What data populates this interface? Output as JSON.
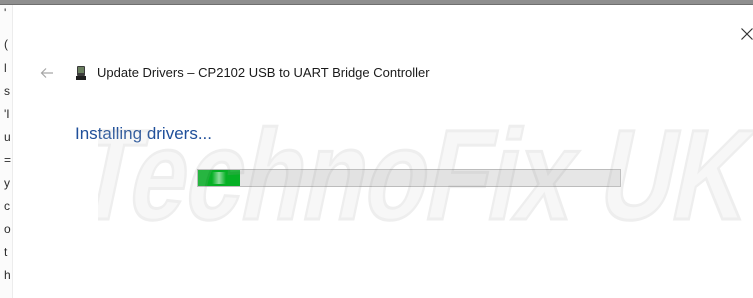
{
  "window": {
    "title": "Update Drivers – CP2102 USB to UART Bridge Controller"
  },
  "status": {
    "heading": "Installing drivers...",
    "progress_percent": 10
  },
  "watermark": {
    "line": "TechnoFix UK"
  },
  "icons": {
    "close": "close-icon",
    "back": "back-arrow-icon",
    "device": "usb-device-icon"
  },
  "colors": {
    "heading": "#1f4f9a",
    "progress_fill": "#06b025",
    "progress_track": "#e6e6e6"
  },
  "background_fragments": [
    "'",
    "(",
    "l",
    "s",
    "'I",
    "u",
    "=",
    "y",
    "c",
    "o",
    "t",
    "h"
  ]
}
